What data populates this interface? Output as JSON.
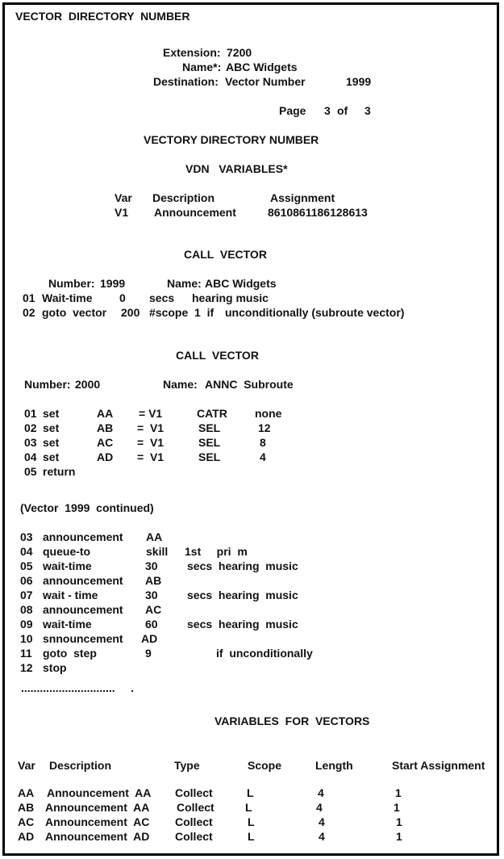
{
  "header": {
    "title": "VECTOR  DIRECTORY  NUMBER",
    "extension_label": "Extension:",
    "extension_value": "7200",
    "name_label": "Name*:",
    "name_value": "ABC Widgets",
    "destination_label": "Destination:",
    "destination_value": "Vector Number",
    "destination_number": "1999",
    "page_label": "Page",
    "page_current": "3",
    "page_of": "of",
    "page_total": "3"
  },
  "vdn_section": {
    "title": "VECTORY DIRECTORY NUMBER",
    "subtitle": "VDN   VARIABLES*",
    "columns": [
      "Var",
      "Description",
      "Assignment"
    ],
    "rows": [
      {
        "var": "V1",
        "description": "Announcement",
        "assignment": "8610861186128613"
      }
    ]
  },
  "call_vector_1": {
    "title": "CALL  VECTOR",
    "number_label": "Number:",
    "number_value": "1999",
    "name_label": "Name:",
    "name_value": "ABC Widgets",
    "steps": [
      {
        "num": "01",
        "cmd": "Wait-time",
        "arg1": "0",
        "arg2": "secs",
        "arg3": "hearing music"
      },
      {
        "num": "02",
        "cmd": "goto  vector",
        "arg1": "200",
        "arg2": "#scope  1  if",
        "arg3": "unconditionally (subroute vector)"
      }
    ]
  },
  "call_vector_2": {
    "title": "CALL  VECTOR",
    "number_label": "Number:",
    "number_value": "2000",
    "name_label": "Name:",
    "name_value": "ANNC  Subroute",
    "steps": [
      {
        "num": "01",
        "cmd": "set",
        "var": "AA",
        "op": "= V1",
        "type": "CATR",
        "val": "none"
      },
      {
        "num": "02",
        "cmd": "set",
        "var": "AB",
        "op": "=  V1",
        "type": "SEL",
        "val": "12"
      },
      {
        "num": "03",
        "cmd": "set",
        "var": "AC",
        "op": "=  V1",
        "type": "SEL",
        "val": "8"
      },
      {
        "num": "04",
        "cmd": "set",
        "var": "AD",
        "op": "=  V1",
        "type": "SEL",
        "val": "4"
      },
      {
        "num": "05",
        "cmd": "return",
        "var": "",
        "op": "",
        "type": "",
        "val": ""
      }
    ]
  },
  "continued": {
    "heading": "(Vector  1999  continued)",
    "steps": [
      {
        "num": "03",
        "cmd": "announcement",
        "arg1": "AA",
        "arg2": "",
        "arg3": ""
      },
      {
        "num": "04",
        "cmd": "queue-to",
        "arg1": "skill",
        "arg2": "1st     pri  m",
        "arg3": ""
      },
      {
        "num": "05",
        "cmd": "wait-time",
        "arg1": "30",
        "arg2": "secs  hearing  music",
        "arg3": ""
      },
      {
        "num": "06",
        "cmd": "announcement",
        "arg1": "AB",
        "arg2": "",
        "arg3": ""
      },
      {
        "num": "07",
        "cmd": "wait - time",
        "arg1": "30",
        "arg2": "secs  hearing  music",
        "arg3": ""
      },
      {
        "num": "08",
        "cmd": "announcement",
        "arg1": "AC",
        "arg2": "",
        "arg3": ""
      },
      {
        "num": "09",
        "cmd": "wait-time",
        "arg1": "60",
        "arg2": "secs  hearing  music",
        "arg3": ""
      },
      {
        "num": "10",
        "cmd": "snnouncement",
        "arg1": "AD",
        "arg2": "",
        "arg3": ""
      },
      {
        "num": "11",
        "cmd": "goto  step",
        "arg1": "9",
        "arg2": "",
        "arg3": "if  unconditionally"
      },
      {
        "num": "12",
        "cmd": "stop",
        "arg1": "",
        "arg2": "",
        "arg3": ""
      }
    ],
    "ellipsis": "..............................     ."
  },
  "variables": {
    "title": "VARIABLES  FOR  VECTORS",
    "columns": [
      "Var",
      "Description",
      "Type",
      "Scope",
      "Length",
      "Start Assignment"
    ],
    "rows": [
      {
        "var": "AA",
        "description": "Announcement  AA",
        "type": "Collect",
        "scope": "L",
        "length": "4",
        "start": "1"
      },
      {
        "var": "AB",
        "description": "Announcement  AA",
        "type": "Collect",
        "scope": "L",
        "length": "4",
        "start": "1"
      },
      {
        "var": "AC",
        "description": "Announcement  AC",
        "type": "Collect",
        "scope": "L",
        "length": "4",
        "start": "1"
      },
      {
        "var": "AD",
        "description": "Announcement  AD",
        "type": "Collect",
        "scope": "L",
        "length": "4",
        "start": "1"
      }
    ]
  }
}
